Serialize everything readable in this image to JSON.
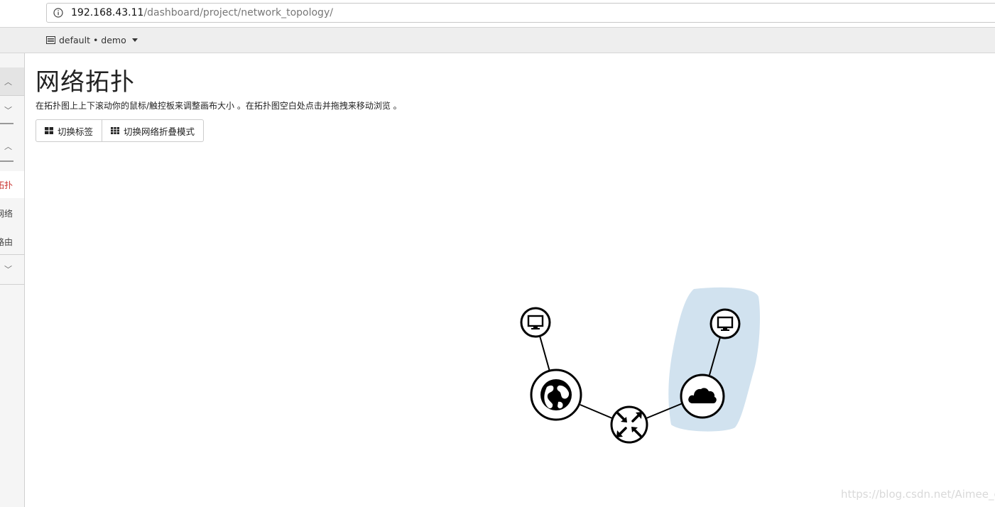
{
  "browser": {
    "url_host": "192.168.43.11",
    "url_path": "/dashboard/project/network_topology/"
  },
  "topnav": {
    "project_label": "default • demo"
  },
  "sidebar": {
    "items": [
      {
        "label": "拓扑",
        "active": true
      },
      {
        "label": "网络"
      },
      {
        "label": "路由"
      }
    ]
  },
  "main": {
    "title": "网络拓扑",
    "help_text": "在拓扑图上上下滚动你的鼠标/触控板来调整画布大小 。在拓扑图空白处点击并拖拽来移动浏览 。",
    "buttons": {
      "toggle_labels": "切换标签",
      "toggle_collapse": "切换网络折叠模式"
    }
  },
  "topology": {
    "nodes": [
      {
        "type": "instance",
        "icon": "monitor-icon"
      },
      {
        "type": "external-network",
        "icon": "globe-icon"
      },
      {
        "type": "router",
        "icon": "router-arrows-icon"
      },
      {
        "type": "network",
        "icon": "cloud-icon"
      },
      {
        "type": "instance",
        "icon": "monitor-icon"
      }
    ],
    "network_highlight_color": "#d1e2ef"
  },
  "watermark": "https://blog.csdn.net/Aimee_c"
}
